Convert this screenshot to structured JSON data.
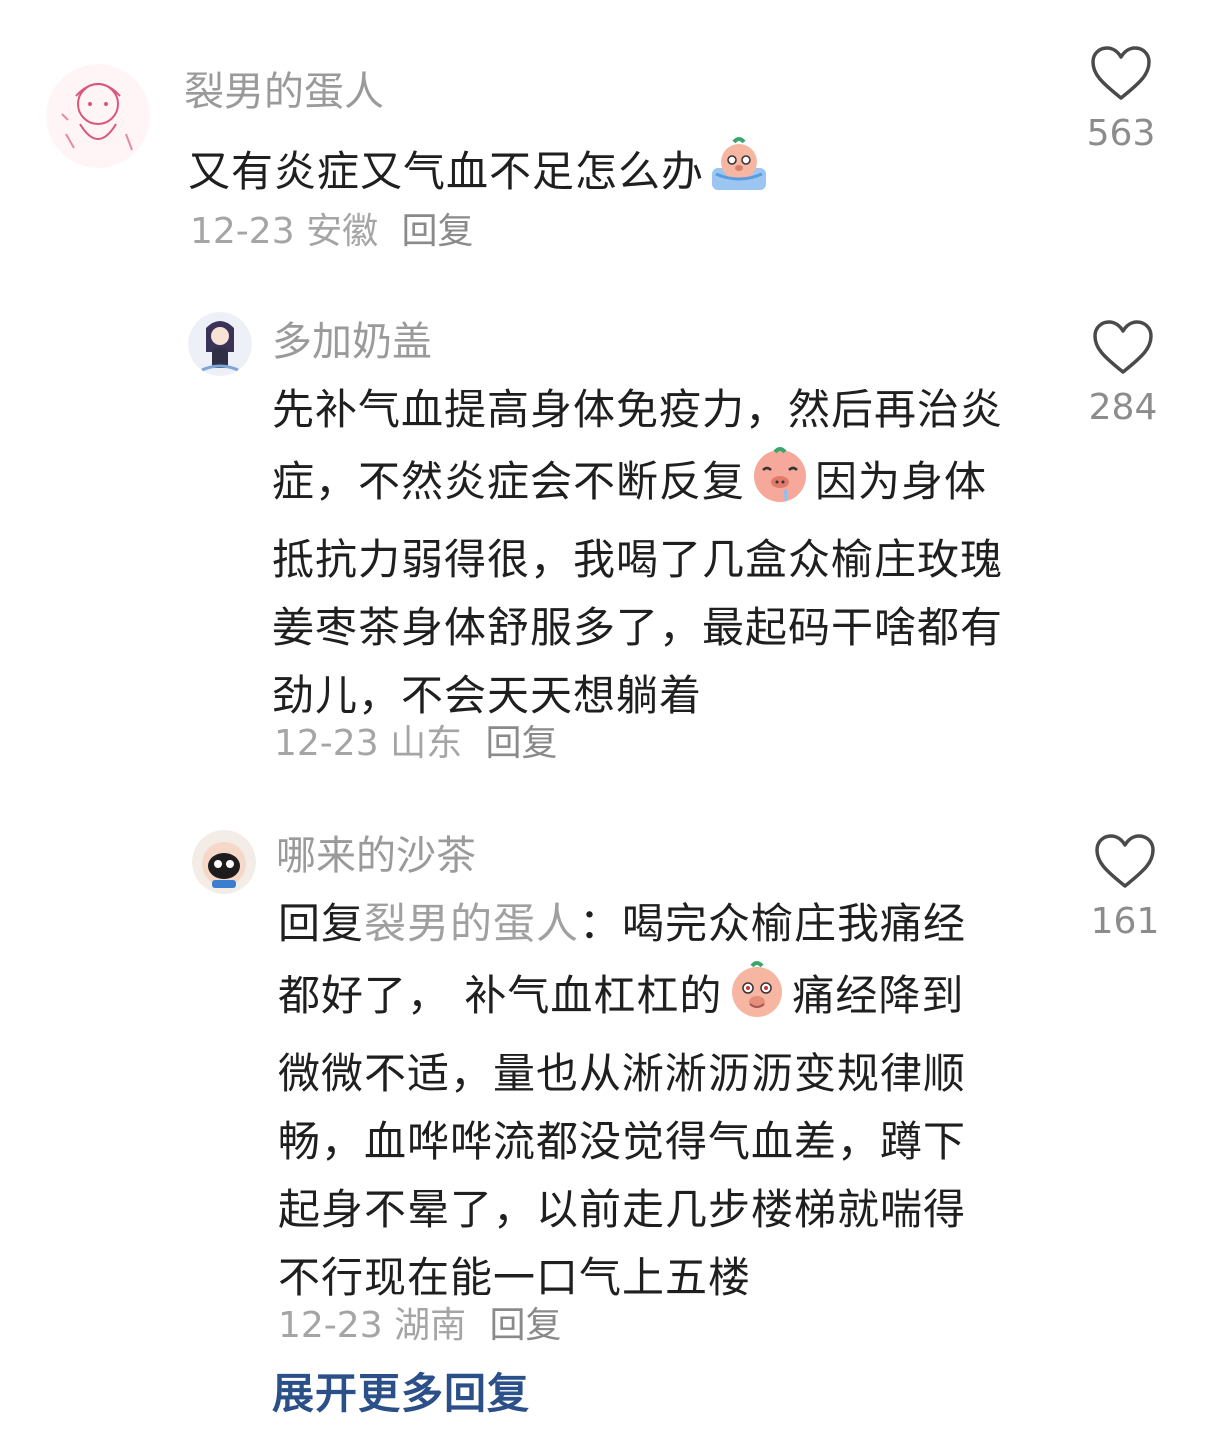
{
  "comments": [
    {
      "username": "裂男的蛋人",
      "text_lines": [
        "又有炎症又气血不足怎么办"
      ],
      "emoji": "crying-pig-emoji",
      "date": "12-23",
      "location": "安徽",
      "reply_label": "回复",
      "likes": "563"
    },
    {
      "username": "多加奶盖",
      "text_lines": [
        "先补气血提高身体免疫力，然后再治炎",
        "症，不然炎症会不断反复",
        "因为身体",
        "抵抗力弱得很，我喝了几盒众榆庄玫瑰",
        "姜枣茶身体舒服多了，最起码干啥都有",
        "劲儿，不会天天想躺着"
      ],
      "emoji": "drooling-pig-emoji",
      "date": "12-23",
      "location": "山东",
      "reply_label": "回复",
      "likes": "284"
    },
    {
      "username": "哪来的沙茶",
      "reply_prefix": "回复",
      "reply_to": "裂男的蛋人",
      "text_lines": [
        "：喝完众榆庄我痛经",
        "都好了， 补气血杠杠的",
        "痛经降到",
        "微微不适，量也从淅淅沥沥变规律顺",
        "畅，血哗哗流都没觉得气血差，蹲下",
        "起身不晕了，以前走几步楼梯就喘得",
        "不行现在能一口气上五楼"
      ],
      "emoji": "shy-pig-emoji",
      "date": "12-23",
      "location": "湖南",
      "reply_label": "回复",
      "likes": "161"
    }
  ],
  "expand_more": "展开更多回复",
  "colors": {
    "username": "#9a9a9a",
    "text": "#1f1f1f",
    "meta": "#a5a5a5",
    "link": "#2b4f88"
  }
}
